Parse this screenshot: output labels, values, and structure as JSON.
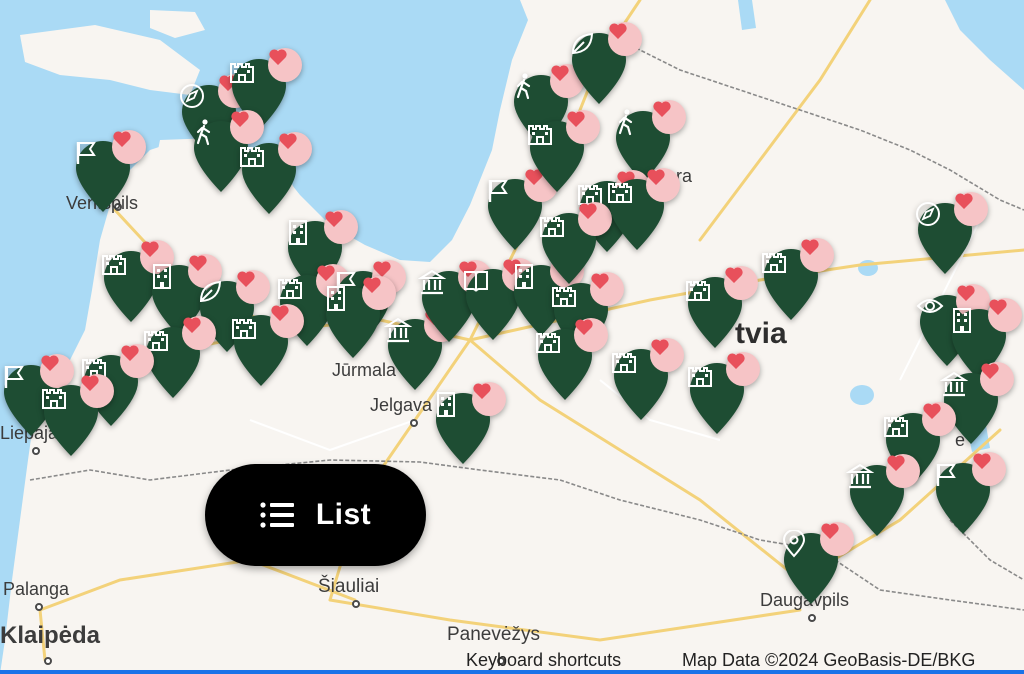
{
  "map": {
    "country_label": "tvia",
    "cities": [
      {
        "name": "Ventspils",
        "label": "Ventspils"
      },
      {
        "name": "Liepaja",
        "label": "Liepaja"
      },
      {
        "name": "Jurmala",
        "label": "Jūrmala"
      },
      {
        "name": "Jelgava",
        "label": "Jelgava"
      },
      {
        "name": "Valmiera",
        "label": "ra"
      },
      {
        "name": "Rezekne",
        "label": "e"
      },
      {
        "name": "Daugavpils",
        "label": "Daugavpils"
      },
      {
        "name": "Palanga",
        "label": "Palanga"
      },
      {
        "name": "Siauliai",
        "label": "Šiauliai"
      },
      {
        "name": "Klaipeda",
        "label": "Klaipėda"
      },
      {
        "name": "Panevezys",
        "label": "Panevėžys"
      }
    ],
    "colors": {
      "water": "#aadaf5",
      "land": "#f8f5f1",
      "pin": "#1e4d33",
      "heart_bg": "#f6c4c6",
      "heart": "#e8505b",
      "road": "#f3d27a",
      "border": "#8a8a8a"
    }
  },
  "pins": [
    {
      "icon": "flag-icon",
      "favorite": true
    },
    {
      "icon": "compass-icon",
      "favorite": true
    },
    {
      "icon": "castle-icon",
      "favorite": true
    },
    {
      "icon": "hiker-icon",
      "favorite": true
    },
    {
      "icon": "castle-icon",
      "favorite": true
    },
    {
      "icon": "castle-icon",
      "favorite": true
    },
    {
      "icon": "building-icon",
      "favorite": true
    },
    {
      "icon": "building-icon",
      "favorite": true
    },
    {
      "icon": "leaf-icon",
      "favorite": true
    },
    {
      "icon": "castle-icon",
      "favorite": true
    },
    {
      "icon": "flag-icon",
      "favorite": true
    },
    {
      "icon": "building-icon",
      "favorite": true
    },
    {
      "icon": "castle-icon",
      "favorite": true
    },
    {
      "icon": "castle-icon",
      "favorite": true
    },
    {
      "icon": "flag-icon",
      "favorite": true
    },
    {
      "icon": "castle-icon",
      "favorite": true
    },
    {
      "icon": "castle-icon",
      "favorite": true
    },
    {
      "icon": "museum-icon",
      "favorite": true
    },
    {
      "icon": "museum-icon",
      "favorite": true
    },
    {
      "icon": "book-icon",
      "favorite": true
    },
    {
      "icon": "building-icon",
      "favorite": true
    },
    {
      "icon": "building-icon",
      "favorite": true
    },
    {
      "icon": "hiker-icon",
      "favorite": true
    },
    {
      "icon": "leaf-icon",
      "favorite": true
    },
    {
      "icon": "hiker-icon",
      "favorite": true
    },
    {
      "icon": "flag-icon",
      "favorite": true
    },
    {
      "icon": "castle-icon",
      "favorite": true
    },
    {
      "icon": "castle-icon",
      "favorite": true
    },
    {
      "icon": "castle-icon",
      "favorite": true
    },
    {
      "icon": "castle-icon",
      "favorite": true
    },
    {
      "icon": "castle-icon",
      "favorite": true
    },
    {
      "icon": "castle-icon",
      "favorite": true
    },
    {
      "icon": "castle-icon",
      "favorite": true
    },
    {
      "icon": "castle-icon",
      "favorite": true
    },
    {
      "icon": "castle-icon",
      "favorite": true
    },
    {
      "icon": "castle-icon",
      "favorite": true
    },
    {
      "icon": "compass-icon",
      "favorite": true
    },
    {
      "icon": "eye-icon",
      "favorite": true
    },
    {
      "icon": "building-icon",
      "favorite": true
    },
    {
      "icon": "museum-icon",
      "favorite": true
    },
    {
      "icon": "castle-icon",
      "favorite": true
    },
    {
      "icon": "museum-icon",
      "favorite": true
    },
    {
      "icon": "flag-icon",
      "favorite": true
    },
    {
      "icon": "location-pin-icon",
      "favorite": true
    }
  ],
  "list_button": {
    "label": "List",
    "icon": "list-icon"
  },
  "footer": {
    "keyboard_shortcuts": "Keyboard shortcuts",
    "map_data": "Map Data ©2024 GeoBasis-DE/BKG"
  }
}
